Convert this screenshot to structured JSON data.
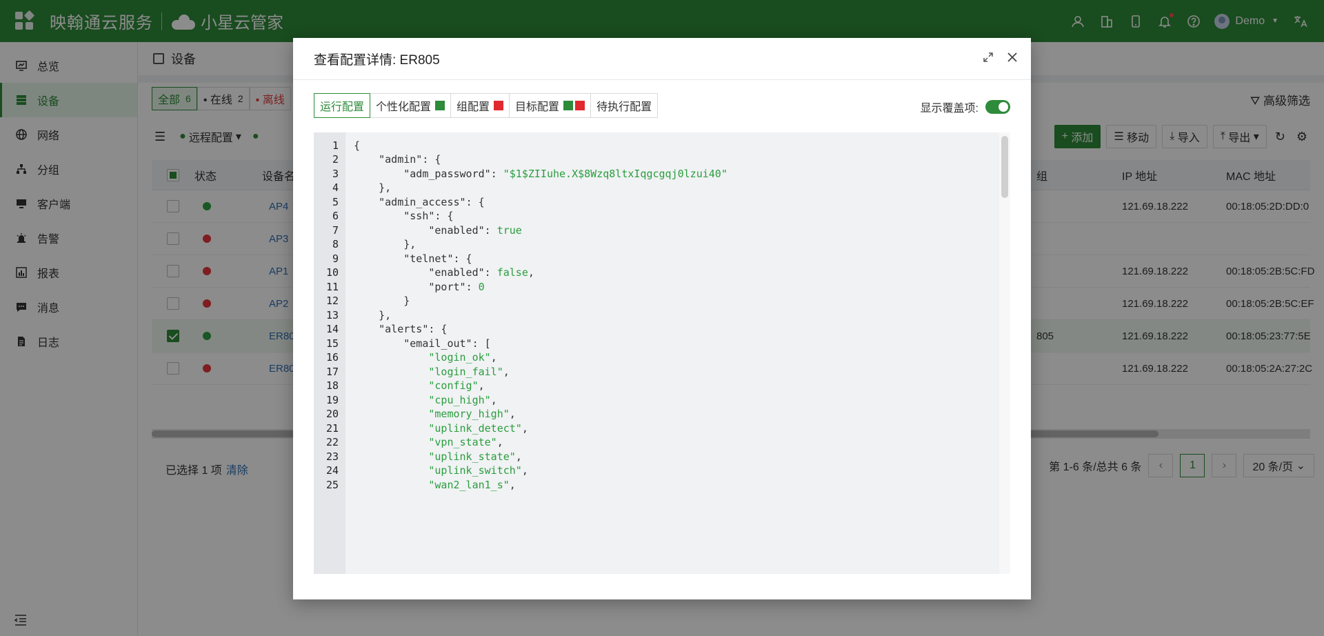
{
  "header": {
    "brand": "映翰通云服务",
    "product": "小星云管家",
    "user": "Demo"
  },
  "sidebar": {
    "items": [
      {
        "label": "总览",
        "icon": "monitor-icon"
      },
      {
        "label": "设备",
        "icon": "server-icon"
      },
      {
        "label": "网络",
        "icon": "globe-icon"
      },
      {
        "label": "分组",
        "icon": "hierarchy-icon"
      },
      {
        "label": "客户端",
        "icon": "desktop-icon"
      },
      {
        "label": "告警",
        "icon": "alarm-icon"
      },
      {
        "label": "报表",
        "icon": "report-icon"
      },
      {
        "label": "消息",
        "icon": "message-icon"
      },
      {
        "label": "日志",
        "icon": "log-icon"
      }
    ],
    "active_index": 1
  },
  "page": {
    "title": "设备",
    "filters": [
      {
        "label": "全部",
        "count": "6"
      },
      {
        "label": "• 在线",
        "count": "2"
      },
      {
        "label": "• 离线",
        "count": ""
      }
    ],
    "advanced_filter": "高级筛选",
    "toolbar": {
      "remote_config": "远程配置",
      "add": "添加",
      "move": "移动",
      "import": "导入",
      "export": "导出"
    },
    "columns": {
      "status": "状态",
      "device": "设备名",
      "group": "组",
      "ip": "IP 地址",
      "mac": "MAC 地址"
    },
    "rows": [
      {
        "name": "AP4",
        "status": "online",
        "group": "",
        "ip": "121.69.18.222",
        "mac": "00:18:05:2D:DD:0",
        "checked": false
      },
      {
        "name": "AP3",
        "status": "offline",
        "group": "",
        "ip": "",
        "mac": "",
        "checked": false
      },
      {
        "name": "AP1",
        "status": "offline",
        "group": "",
        "ip": "121.69.18.222",
        "mac": "00:18:05:2B:5C:FD",
        "checked": false
      },
      {
        "name": "AP2",
        "status": "offline",
        "group": "",
        "ip": "121.69.18.222",
        "mac": "00:18:05:2B:5C:EF",
        "checked": false
      },
      {
        "name": "ER80",
        "status": "online",
        "group": "805",
        "ip": "121.69.18.222",
        "mac": "00:18:05:23:77:5E",
        "checked": true
      },
      {
        "name": "ER80",
        "status": "offline",
        "group": "",
        "ip": "121.69.18.222",
        "mac": "00:18:05:2A:27:2C",
        "checked": false
      }
    ],
    "footer": {
      "selected_text": "已选择 1 项",
      "clear": "清除",
      "range": "第 1-6 条/总共 6 条",
      "current_page": "1",
      "page_size": "20 条/页"
    }
  },
  "modal": {
    "title": "查看配置详情: ER805",
    "tabs": [
      {
        "label": "运行配置",
        "marks": []
      },
      {
        "label": "个性化配置",
        "marks": [
          "green"
        ]
      },
      {
        "label": "组配置",
        "marks": [
          "red"
        ]
      },
      {
        "label": "目标配置",
        "marks": [
          "green",
          "red"
        ]
      },
      {
        "label": "待执行配置",
        "marks": []
      }
    ],
    "active_tab": 0,
    "show_overrides_label": "显示覆盖项:",
    "show_overrides": true,
    "code_lines": [
      "{",
      "    \"admin\": {",
      "        \"adm_password\": \"$1$ZIIuhe.X$8Wzq8ltxIqgcgqj0lzui40\"",
      "    },",
      "    \"admin_access\": {",
      "        \"ssh\": {",
      "            \"enabled\": true",
      "        },",
      "        \"telnet\": {",
      "            \"enabled\": false,",
      "            \"port\": 0",
      "        }",
      "    },",
      "    \"alerts\": {",
      "        \"email_out\": [",
      "            \"login_ok\",",
      "            \"login_fail\",",
      "            \"config\",",
      "            \"cpu_high\",",
      "            \"memory_high\",",
      "            \"uplink_detect\",",
      "            \"vpn_state\",",
      "            \"uplink_state\",",
      "            \"uplink_switch\",",
      "            \"wan2_lan1_s\","
    ]
  },
  "colors": {
    "brand_green": "#2e8b3a",
    "online": "#2ea043",
    "offline": "#e5383b",
    "string_green": "#2a9d3c"
  }
}
